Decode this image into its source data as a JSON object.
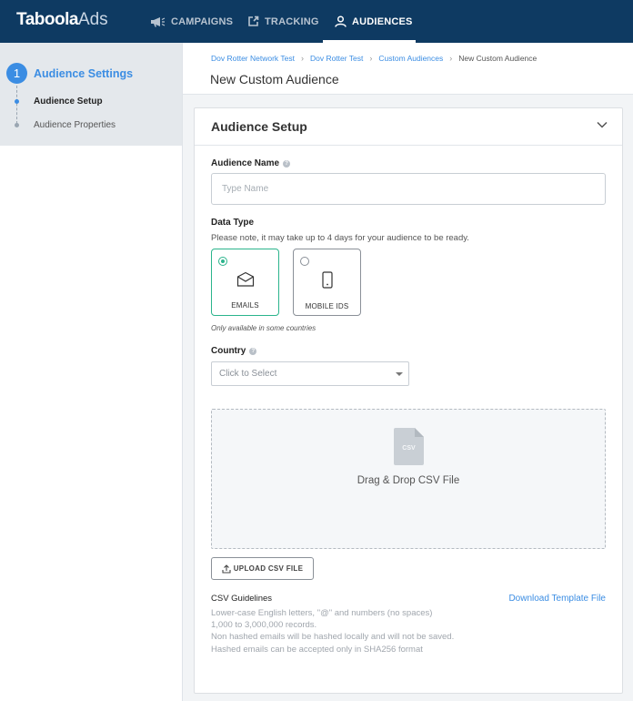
{
  "app": {
    "logo_brand": "Taboola",
    "logo_suffix": "Ads"
  },
  "nav": {
    "items": [
      {
        "label": "CAMPAIGNS",
        "icon": "megaphone-icon",
        "active": false
      },
      {
        "label": "TRACKING",
        "icon": "tracking-icon",
        "active": false
      },
      {
        "label": "AUDIENCES",
        "icon": "user-icon",
        "active": true
      }
    ]
  },
  "sidebar": {
    "step_number": "1",
    "step_title": "Audience Settings",
    "sub_steps": [
      {
        "label": "Audience Setup",
        "active": true
      },
      {
        "label": "Audience Properties",
        "active": false
      }
    ]
  },
  "breadcrumb": [
    {
      "label": "Dov Rotter Network Test"
    },
    {
      "label": "Dov Rotter Test"
    },
    {
      "label": "Custom Audiences"
    },
    {
      "label": "New Custom Audience"
    }
  ],
  "page_title": "New Custom Audience",
  "card": {
    "title": "Audience Setup",
    "audience_name_label": "Audience Name",
    "audience_name_placeholder": "Type Name",
    "audience_name_value": "",
    "data_type_label": "Data Type",
    "data_type_note": "Please note, it may take up to 4 days for your audience to be ready.",
    "data_types": [
      {
        "label": "EMAILS",
        "icon": "email-icon",
        "selected": true
      },
      {
        "label": "MOBILE IDS",
        "icon": "mobile-icon",
        "selected": false
      }
    ],
    "availability_note": "Only available in some countries",
    "country_label": "Country",
    "country_placeholder": "Click to Select",
    "dropzone_file_label": "CSV",
    "dropzone_text": "Drag & Drop CSV File",
    "upload_button": "UPLOAD CSV FILE",
    "guidelines_title": "CSV Guidelines",
    "download_link": "Download Template File",
    "guidelines": [
      "Lower-case English letters, \"@\" and numbers (no spaces)",
      "1,000 to 3,000,000 records.",
      "Non hashed emails will be hashed locally and will not be saved.",
      "Hashed emails can be accepted only in SHA256 format"
    ]
  },
  "colors": {
    "nav_bg": "#0e3a62",
    "accent_blue": "#3b8de3",
    "selected_green": "#2bb48c"
  }
}
